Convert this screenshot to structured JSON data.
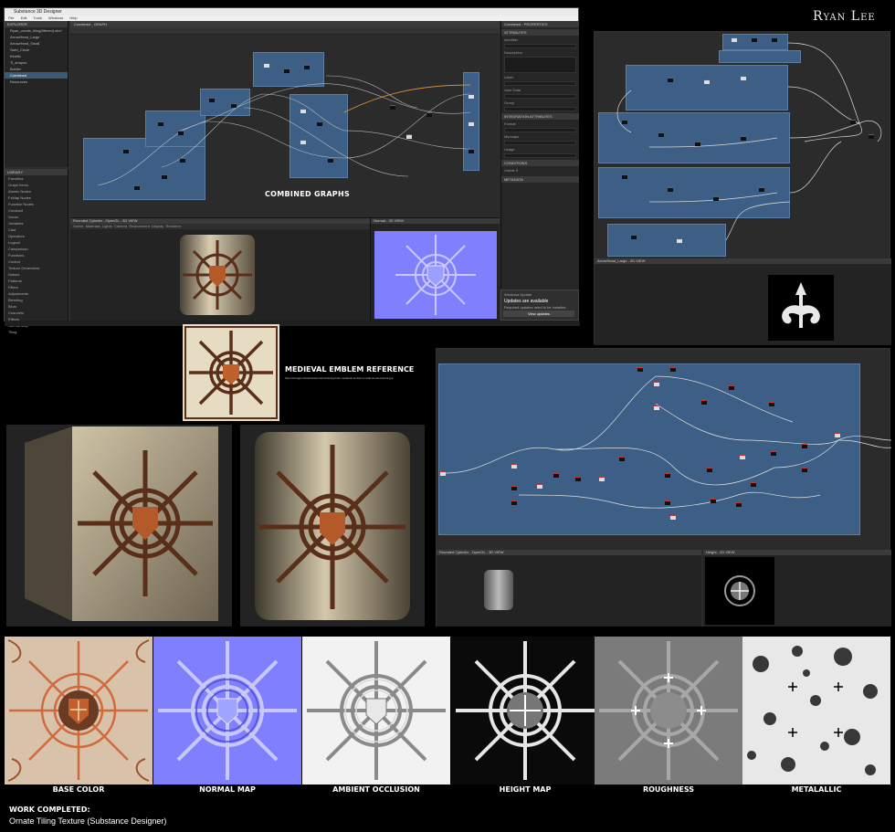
{
  "author": "Ryan Lee",
  "designer_window": {
    "title": "Substance 3D Designer",
    "menu": [
      "File",
      "Edit",
      "Tools",
      "Windows",
      "Help"
    ],
    "explorer": {
      "title": "EXPLORER",
      "items": [
        "Ryan_ornate_tiling(filtered).sbs*",
        "ArrowHead_Large",
        "ArrowHead_Small",
        "Swirl_Circle",
        "Kinetic",
        "Ti_shapes",
        "Border",
        "Combined",
        "Resources"
      ],
      "selected_index": 7
    },
    "library": {
      "title": "LIBRARY",
      "items": [
        "Favorites",
        "Graph Items",
        "Atomic Nodes",
        "FxMap Nodes",
        "Function Nodes",
        "Constant",
        "Vector",
        "Variables",
        "Cast",
        "Operators",
        "Logical",
        "Comparison",
        "Functions",
        "Control",
        "Texture Generators",
        "Noises",
        "Patterns",
        "Filters",
        "Adjustments",
        "Blending",
        "Blurs",
        "Channels",
        "Effects",
        "Normal Map",
        "Tiling"
      ]
    },
    "graph_tab": "Combined - GRAPH",
    "props": {
      "title": "Combined - PROPERTIES",
      "sections": [
        "ATTRIBUTES",
        "OUTPUT SIZE",
        "INTEGRATION ATTRIBUTES",
        "CONDITIONS",
        "METADATA"
      ],
      "labels": [
        "Identifier",
        "Description",
        "Label",
        "User Data",
        "Group",
        "Format",
        "Mipmaps",
        "Usage",
        "Visible If"
      ]
    },
    "viewport3d_title": "Rounded Cylinder - OpenGL - 3D VIEW",
    "viewport3d_menu": [
      "Scene",
      "Materials",
      "Lights",
      "Camera",
      "Environment",
      "Display",
      "Renderer"
    ],
    "viewport2d_title": "Normal - 2D VIEW",
    "notification": {
      "source": "Windows Update",
      "headline": "Updates are available",
      "body": "Required updates need to be installed.",
      "button": "View updates"
    }
  },
  "captions": {
    "combined_graphs": "COMBINED GRAPHS",
    "reference": "MEDIEVAL EMBLEM REFERENCE",
    "reference_url": "https://images.shutterstock.com/z/stock-photo-medieval-emblem-metal-ornate-texture.jpg",
    "arrowhead_view": "ArrowHead_Large - 2D VIEW",
    "cylinder_view": "Rounded Cylinder - OpenGL - 3D VIEW",
    "height_view": "Height - 2D VIEW"
  },
  "maps": [
    "BASE COLOR",
    "NORMAL MAP",
    "AMBIENT OCCLUSION",
    "HEIGHT MAP",
    "ROUGHNESS",
    "METALALLIC"
  ],
  "work": {
    "label": "WORK COMPLETED:",
    "text": "Ornate Tiling Texture (Substance Designer)"
  },
  "colors": {
    "frame_blue": "#3d5f85",
    "normal_blue": "#8080ff",
    "metal": "#b9ab90",
    "copper": "#a0522d"
  }
}
